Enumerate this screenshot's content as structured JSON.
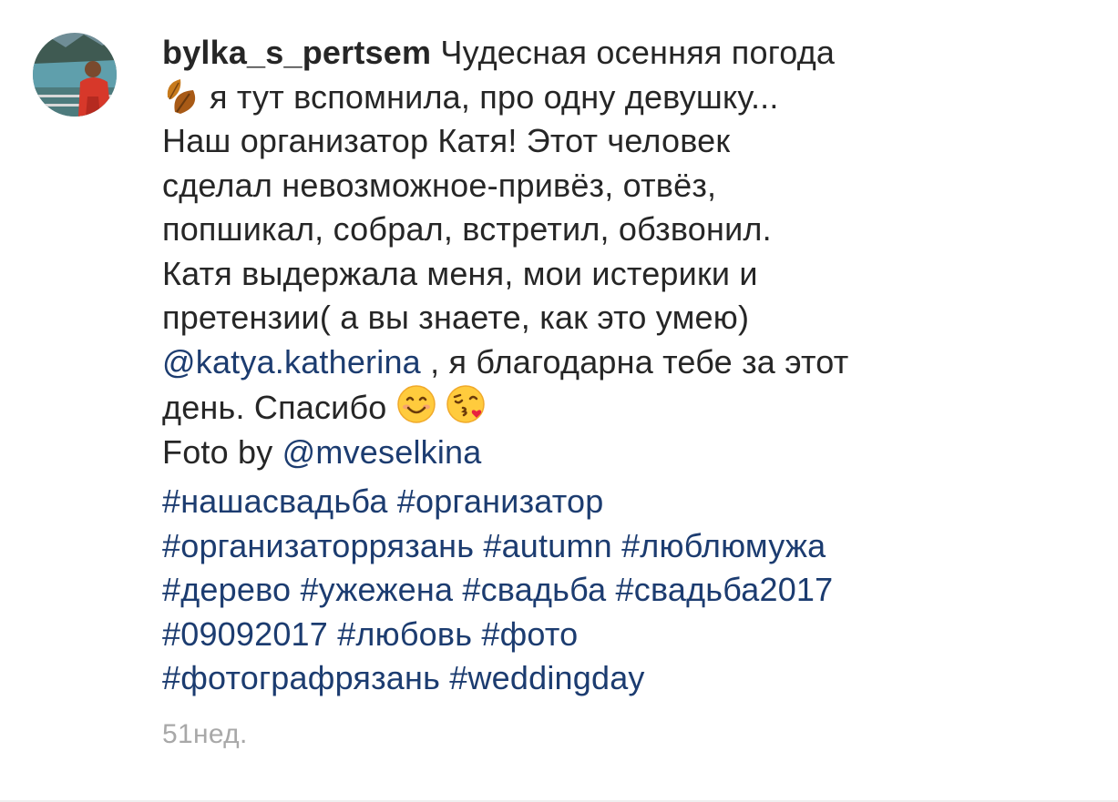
{
  "post": {
    "username": "bylka_s_pertsem",
    "lines": [
      "Чудесная осенняя погода",
      "я тут вспомнила, про одну девушку...",
      "Наш организатор Катя! Этот человек",
      "сделал невозможное-привёз, отвёз,",
      "попшикал, собрал, встретил, обзвонил.",
      "Катя выдержала меня, мои истерики и",
      "претензии( а вы знаете, как это умею)"
    ],
    "mention_1": "@katya.katherina",
    "after_mention_1": " , я благодарна тебе за этот",
    "thanks_text": "день. Спасибо",
    "foto_by": "Foto by ",
    "mention_2": "@mveselkina",
    "hashtag_lines": [
      [
        "#нашасвадьба",
        "#организатор"
      ],
      [
        "#организаторрязань",
        "#autumn",
        "#люблюмужа"
      ],
      [
        "#дерево",
        "#ужежена",
        "#свадьба",
        "#свадьба2017"
      ],
      [
        "#09092017",
        "#любовь",
        "#фото"
      ],
      [
        "#фотографрязань",
        "#weddingday"
      ]
    ],
    "timestamp": "51нед."
  },
  "icons": {
    "avatar": "profile-photo",
    "leaves": "fallen-leaf-emoji",
    "smile": "smiling-face-emoji",
    "kiss": "face-blowing-kiss-emoji"
  },
  "colors": {
    "text": "#262626",
    "link": "#1c3c70",
    "timestamp": "#a8a8a8"
  }
}
